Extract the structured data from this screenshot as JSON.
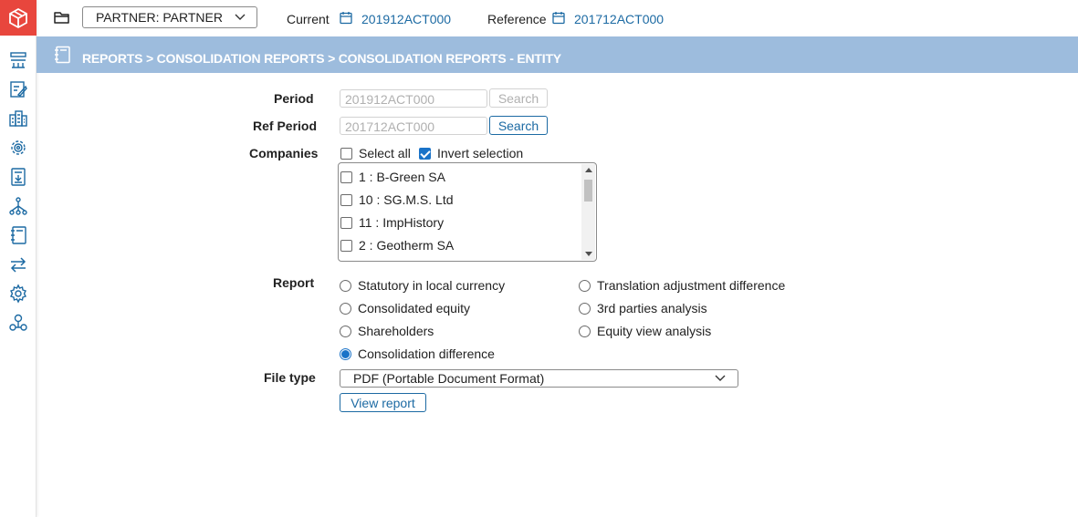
{
  "topbar": {
    "partner_select": "PARTNER: PARTNER",
    "current_label": "Current",
    "current_value": "201912ACT000",
    "reference_label": "Reference",
    "reference_value": "201712ACT000"
  },
  "breadcrumb": "REPORTS > CONSOLIDATION REPORTS > CONSOLIDATION REPORTS - ENTITY",
  "sidebar": {
    "icons": [
      "consolidation-icon",
      "journal-edit-icon",
      "companies-icon",
      "settings-network-icon",
      "document-download-icon",
      "hierarchy-icon",
      "notebook-icon",
      "transfer-icon",
      "gear-icon",
      "user-network-icon"
    ]
  },
  "form": {
    "period_label": "Period",
    "period_value": "201912ACT000",
    "period_search": "Search",
    "ref_period_label": "Ref Period",
    "ref_period_value": "201712ACT000",
    "ref_period_search": "Search",
    "companies_label": "Companies",
    "select_all": {
      "label": "Select all",
      "checked": false
    },
    "invert_selection": {
      "label": "Invert selection",
      "checked": true
    },
    "companies": [
      {
        "label": "1 : B-Green SA",
        "checked": false
      },
      {
        "label": "10 : SG.M.S. Ltd",
        "checked": false
      },
      {
        "label": "11 : ImpHistory",
        "checked": false
      },
      {
        "label": "2 : Geotherm SA",
        "checked": false
      }
    ],
    "report_label": "Report",
    "reports": [
      {
        "label": "Statutory in local currency",
        "selected": false
      },
      {
        "label": "Translation adjustment difference",
        "selected": false
      },
      {
        "label": "Consolidated equity",
        "selected": false
      },
      {
        "label": "3rd parties analysis",
        "selected": false
      },
      {
        "label": "Shareholders",
        "selected": false
      },
      {
        "label": "Equity view analysis",
        "selected": false
      },
      {
        "label": "Consolidation difference",
        "selected": true
      }
    ],
    "file_type_label": "File type",
    "file_type_value": "PDF (Portable Document Format)",
    "view_report": "View report"
  },
  "colors": {
    "accent": "#1c6aa3",
    "band": "#9dbcdd",
    "logo": "#e8463d",
    "checked": "#1a73c8"
  }
}
